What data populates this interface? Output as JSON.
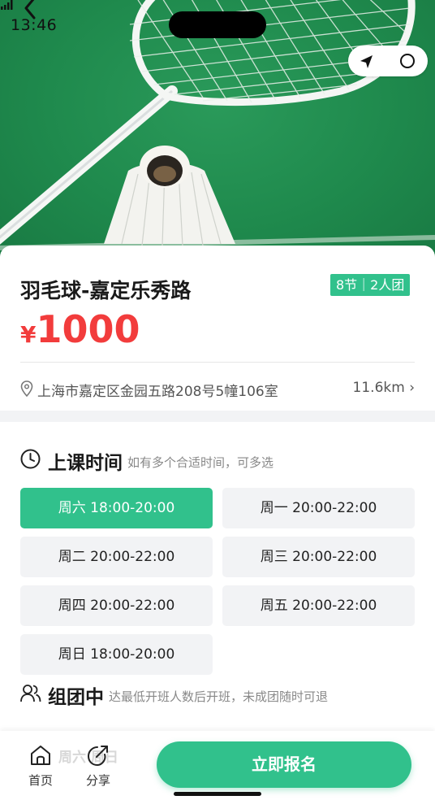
{
  "status_bar": {
    "time": "13:46"
  },
  "course": {
    "title": "羽毛球-嘉定乐秀路",
    "tag": "8节｜2人团",
    "currency": "¥",
    "price": "1000",
    "address": "上海市嘉定区金园五路208号5幢106室",
    "distance": "11.6km ›"
  },
  "schedule": {
    "title": "上课时间",
    "hint": "如有多个合适时间，可多选",
    "slots": [
      {
        "label": "周六 18:00-20:00",
        "selected": true
      },
      {
        "label": "周一 20:00-22:00",
        "selected": false
      },
      {
        "label": "周二 20:00-22:00",
        "selected": false
      },
      {
        "label": "周三 20:00-22:00",
        "selected": false
      },
      {
        "label": "周四 20:00-22:00",
        "selected": false
      },
      {
        "label": "周五 20:00-22:00",
        "selected": false
      },
      {
        "label": "周日 18:00-20:00",
        "selected": false
      }
    ]
  },
  "group": {
    "title": "组团中",
    "hint": "达最低开班人数后开班，未成团随时可退"
  },
  "bottom_bar": {
    "ghost_text": "周六 周日",
    "home_label": "首页",
    "share_label": "分享",
    "signup_label": "立即报名"
  },
  "colors": {
    "accent": "#31c18c",
    "price": "#f23c3c"
  }
}
